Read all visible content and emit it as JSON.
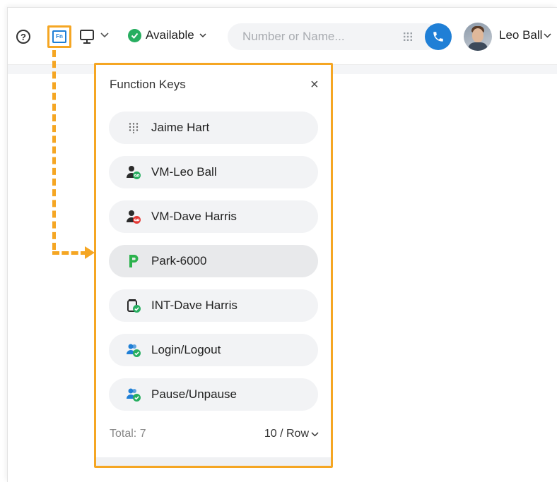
{
  "topbar": {
    "help_glyph": "?",
    "fn_label": "Fn",
    "status_label": "Available",
    "search_placeholder": "Number or Name...",
    "user_name": "Leo Ball",
    "chevron": "∨"
  },
  "panel": {
    "title": "Function Keys",
    "close_glyph": "×",
    "keys": [
      {
        "label": "Jaime Hart",
        "icon": "keypad-icon"
      },
      {
        "label": "VM-Leo Ball",
        "icon": "voicemail-contact-icon"
      },
      {
        "label": "VM-Dave Harris",
        "icon": "voicemail-contact-icon"
      },
      {
        "label": "Park-6000",
        "icon": "park-icon"
      },
      {
        "label": "INT-Dave Harris",
        "icon": "intercom-icon"
      },
      {
        "label": "Login/Logout",
        "icon": "queue-login-icon"
      },
      {
        "label": "Pause/Unpause",
        "icon": "queue-pause-icon"
      }
    ],
    "total": "Total: 7",
    "per_row": "10 / Row"
  },
  "colors": {
    "accent_orange": "#f5a623",
    "brand_blue": "#1f7fd6",
    "available_green": "#27ae60",
    "park_green": "#2bb24c"
  }
}
